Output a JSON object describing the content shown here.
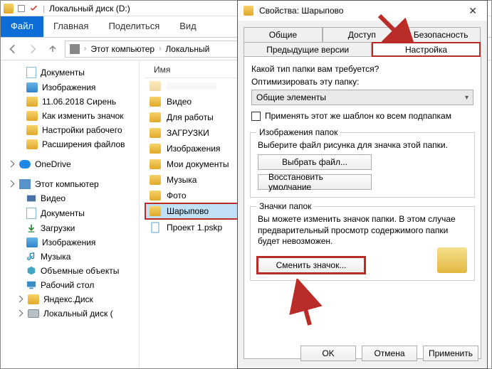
{
  "explorer": {
    "title": "Локальный диск (D:)",
    "ribbon": {
      "file": "Файл",
      "tabs": [
        "Главная",
        "Поделиться",
        "Вид"
      ]
    },
    "breadcrumb": [
      "Этот компьютер",
      "Локальный"
    ],
    "tree": {
      "quick": [
        {
          "label": "Документы",
          "icon": "doc"
        },
        {
          "label": "Изображения",
          "icon": "folder"
        },
        {
          "label": "11.06.2018 Сирень",
          "icon": "folder"
        },
        {
          "label": "Как изменить значок",
          "icon": "folder"
        },
        {
          "label": "Настройки рабочего",
          "icon": "folder"
        },
        {
          "label": "Расширения файлов",
          "icon": "folder"
        }
      ],
      "onedrive": "OneDrive",
      "thispc": "Этот компьютер",
      "pc_items": [
        {
          "label": "Видео",
          "icon": "video"
        },
        {
          "label": "Документы",
          "icon": "doc"
        },
        {
          "label": "Загрузки",
          "icon": "down"
        },
        {
          "label": "Изображения",
          "icon": "img"
        },
        {
          "label": "Музыка",
          "icon": "music"
        },
        {
          "label": "Объемные объекты",
          "icon": "cube"
        },
        {
          "label": "Рабочий стол",
          "icon": "desk"
        },
        {
          "label": "Яндекс.Диск",
          "icon": "folder"
        },
        {
          "label": "Локальный диск (",
          "icon": "drive"
        }
      ]
    },
    "list_header": "Имя",
    "files": [
      {
        "label": "",
        "icon": "folder",
        "faded": true
      },
      {
        "label": "Видео",
        "icon": "folder"
      },
      {
        "label": "Для работы",
        "icon": "folder"
      },
      {
        "label": "ЗАГРУЗКИ",
        "icon": "folder"
      },
      {
        "label": "Изображения",
        "icon": "folder"
      },
      {
        "label": "Мои документы",
        "icon": "folder"
      },
      {
        "label": "Музыка",
        "icon": "folder"
      },
      {
        "label": "Фото",
        "icon": "folder"
      },
      {
        "label": "Шарыпово",
        "icon": "folder",
        "selected": true
      },
      {
        "label": "Проект 1.pskp",
        "icon": "file"
      }
    ]
  },
  "props": {
    "title": "Свойства: Шарыпово",
    "tabs_row1": [
      "Общие",
      "Доступ",
      "Безопасность"
    ],
    "tabs_row2": [
      "Предыдущие версии",
      "Настройка"
    ],
    "q1": "Какой тип папки вам требуется?",
    "q2": "Оптимизировать эту папку:",
    "dropdown": "Общие элементы",
    "apply_sub": "Применять этот же шаблон ко всем подпапкам",
    "grp_img": {
      "title": "Изображения папок",
      "text": "Выберите файл рисунка для значка этой папки.",
      "choose": "Выбрать файл...",
      "restore": "Восстановить умолчание"
    },
    "grp_icon": {
      "title": "Значки папок",
      "text": "Вы можете изменить значок папки. В этом случае предварительный просмотр содержимого папки будет невозможен.",
      "change": "Сменить значок..."
    },
    "buttons": {
      "ok": "OK",
      "cancel": "Отмена",
      "apply": "Применить"
    },
    "close": "✕"
  }
}
